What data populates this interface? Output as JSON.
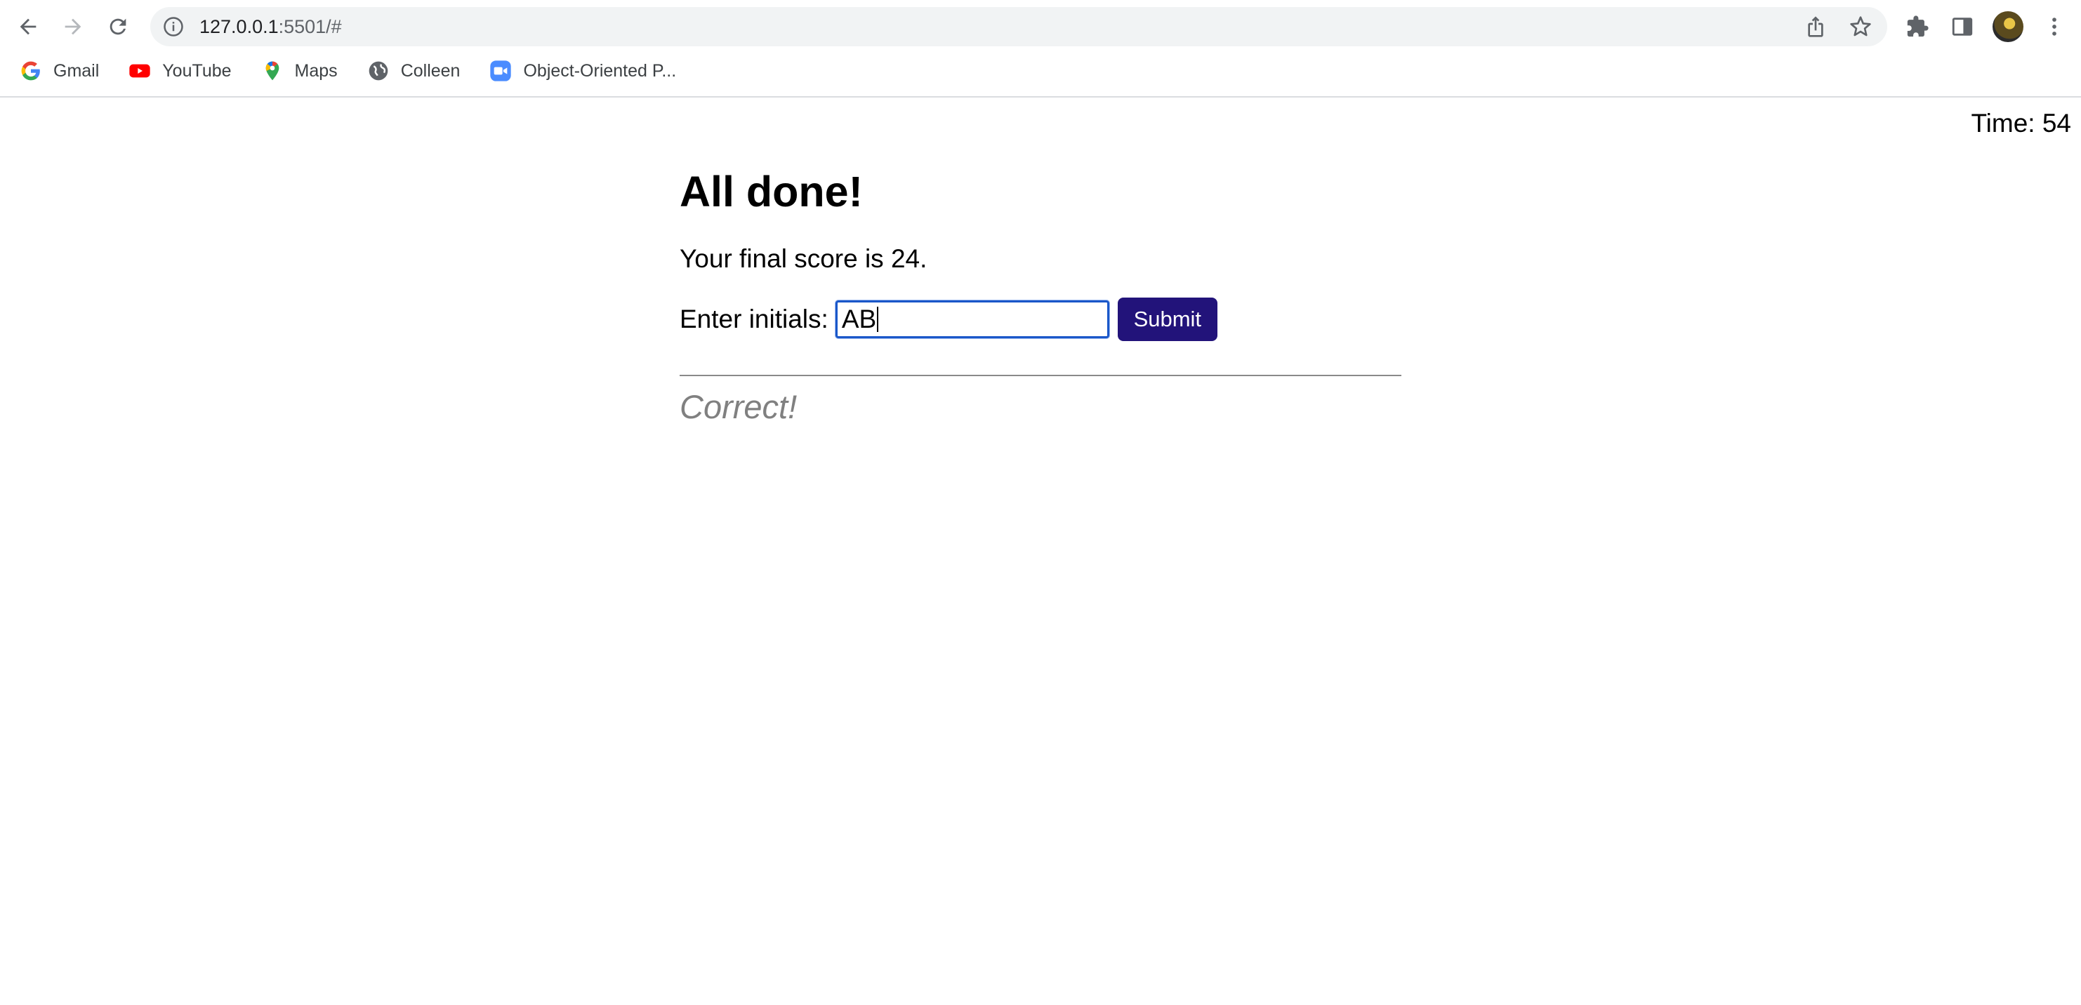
{
  "browser": {
    "url_host": "127.0.0.1",
    "url_rest": ":5501/#",
    "bookmarks": [
      {
        "label": "Gmail",
        "icon": "google-icon"
      },
      {
        "label": "YouTube",
        "icon": "youtube-icon"
      },
      {
        "label": "Maps",
        "icon": "maps-icon"
      },
      {
        "label": "Colleen",
        "icon": "globe-icon"
      },
      {
        "label": "Object-Oriented P...",
        "icon": "zoom-video-icon"
      }
    ]
  },
  "page": {
    "timer": "Time: 54",
    "heading": "All done!",
    "score_text": "Your final score is 24.",
    "initials_label": "Enter initials:",
    "initials_value": "AB",
    "submit_label": "Submit",
    "feedback": "Correct!"
  },
  "colors": {
    "submit_bg": "#22137a",
    "input_focus_border": "#1a57c9",
    "feedback_text": "#808080"
  }
}
